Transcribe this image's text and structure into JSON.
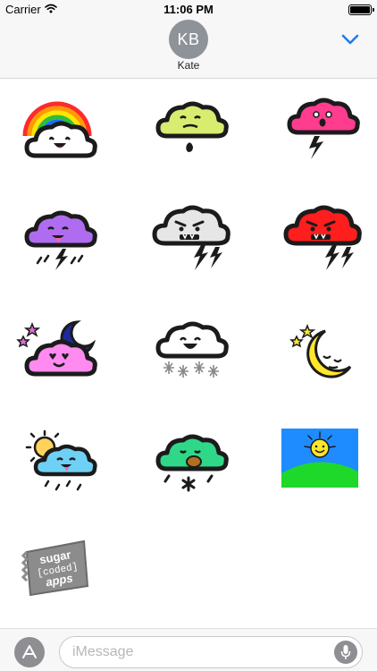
{
  "status_bar": {
    "carrier": "Carrier",
    "time": "11:06 PM",
    "battery_level": 1.0
  },
  "header": {
    "avatar_initials": "KB",
    "contact_name": "Kate",
    "collapse_icon": "chevron-down-icon",
    "accent_color": "#1f7cf2"
  },
  "stickers": [
    {
      "name": "rainbow-cloud-sticker"
    },
    {
      "name": "sick-green-cloud-sticker"
    },
    {
      "name": "pink-storm-cloud-sticker"
    },
    {
      "name": "purple-storm-cloud-sticker"
    },
    {
      "name": "angry-gray-storm-cloud-sticker"
    },
    {
      "name": "angry-red-storm-cloud-sticker"
    },
    {
      "name": "love-night-cloud-sticker"
    },
    {
      "name": "snow-cloud-sticker"
    },
    {
      "name": "sleepy-moon-sticker"
    },
    {
      "name": "sun-rain-cloud-sticker"
    },
    {
      "name": "green-snow-cloud-sticker"
    },
    {
      "name": "sun-hill-sticker"
    },
    {
      "name": "sugar-coded-apps-logo",
      "logo_text": [
        "sugar",
        "[coded]",
        "apps"
      ]
    }
  ],
  "input_bar": {
    "placeholder": "iMessage",
    "value": "",
    "app_store_icon": "app-store-icon",
    "mic_icon": "microphone-icon"
  }
}
